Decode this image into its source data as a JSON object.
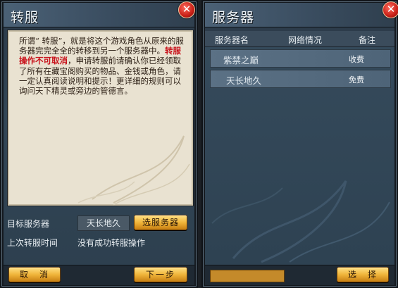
{
  "left_panel": {
    "title": "转服",
    "close_glyph": "✕",
    "desc_part1": "所谓“ 转服”，就是将这个游戏角色从原来的服务器完完全全的转移到另一个服务器中。",
    "desc_warning": "转服操作不可取消",
    "desc_part2": "，申请转服前请确认你已经领取了所有在藏宝阁购买的物品、金钱或角色，请一定认真阅读说明和提示！更详细的规则可以询问天下精灵或旁边的管德言。",
    "target_label": "目标服务器",
    "target_value": "天长地久",
    "select_server_button": "选服务器",
    "last_transfer_label": "上次转服时间",
    "last_transfer_value": "没有成功转服操作",
    "cancel_button": "取　消",
    "next_button": "下一步"
  },
  "right_panel": {
    "title": "服务器",
    "close_glyph": "✕",
    "columns": [
      "服务器名",
      "网络情况",
      "备注"
    ],
    "servers": [
      {
        "name": "紫禁之巅",
        "network": "",
        "note": "收费"
      },
      {
        "name": "天长地久",
        "network": "",
        "note": "免费"
      }
    ],
    "select_button": "选　择"
  },
  "colors": {
    "accent_gold": "#f0b53a",
    "warning_red": "#c8121b",
    "close_red": "#c81f16"
  },
  "icons": {
    "close": "close-icon"
  }
}
